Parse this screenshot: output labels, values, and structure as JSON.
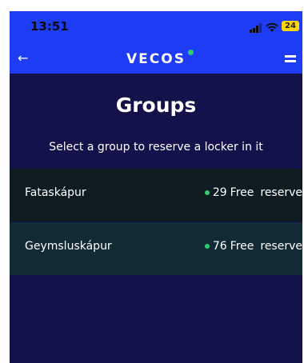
{
  "status_bar": {
    "time": "13:51",
    "battery": "24",
    "icons": [
      "signal-icon",
      "wifi-icon",
      "battery-icon"
    ]
  },
  "nav": {
    "brand": "VECOS",
    "back_icon": "back-arrow-icon",
    "menu_icon": "menu-icon"
  },
  "page": {
    "title": "Groups",
    "subtitle": "Select a group to reserve a locker in it"
  },
  "groups": [
    {
      "name": "Fataskápur",
      "free_count": "29",
      "free_label": "Free",
      "action": "reserve"
    },
    {
      "name": "Geymsluskápur",
      "free_count": "76",
      "free_label": "Free",
      "action": "reserve"
    }
  ],
  "colors": {
    "header": "#1d3cf4",
    "background": "#14124a",
    "row_dark": "#0e1c22",
    "row_mid": "#112a33",
    "free_dot": "#2ecc71",
    "battery": "#ffd60a"
  }
}
